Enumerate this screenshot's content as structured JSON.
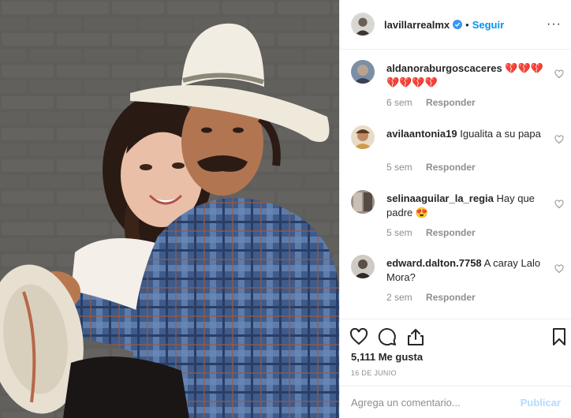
{
  "post": {
    "username": "lavillarrealmx",
    "separator": "•",
    "follow_label": "Seguir",
    "more_label": "···",
    "likes": "5,111 Me gusta",
    "date": "16 DE JUNIO",
    "comment_placeholder": "Agrega un comentario...",
    "publish_label": "Publicar"
  },
  "comments": [
    {
      "user": "aldanoraburgoscaceres",
      "text": "💔💔💔💔💔💔💔",
      "age": "6 sem",
      "reply": "Responder"
    },
    {
      "user": "avilaantonia19",
      "text": "Igualita a su papa",
      "age": "5 sem",
      "reply": "Responder"
    },
    {
      "user": "selinaaguilar_la_regia",
      "text": "Hay que padre 😍",
      "age": "5 sem",
      "reply": "Responder"
    },
    {
      "user": "edward.dalton.7758",
      "text": "A caray Lalo Mora?",
      "age": "2 sem",
      "reply": "Responder"
    }
  ],
  "icons": {
    "like": "heart-icon",
    "comment": "comment-icon",
    "share": "share-icon",
    "save": "bookmark-icon",
    "verified": "verified-badge-icon"
  },
  "colors": {
    "link_blue": "#0095f6",
    "verified_blue": "#3897f0",
    "muted": "#8e8e8e",
    "publish_disabled": "#b3dbff",
    "border": "#efefef"
  }
}
